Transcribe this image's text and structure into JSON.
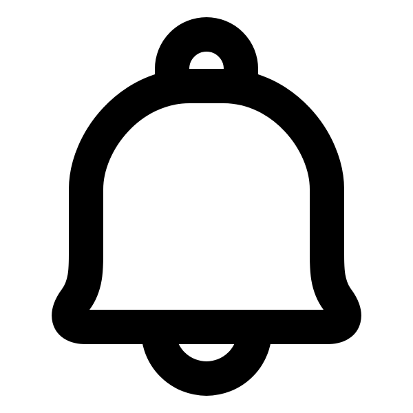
{
  "icon": {
    "name": "bell-icon",
    "stroke_color": "#000000",
    "background_color": "#ffffff"
  }
}
